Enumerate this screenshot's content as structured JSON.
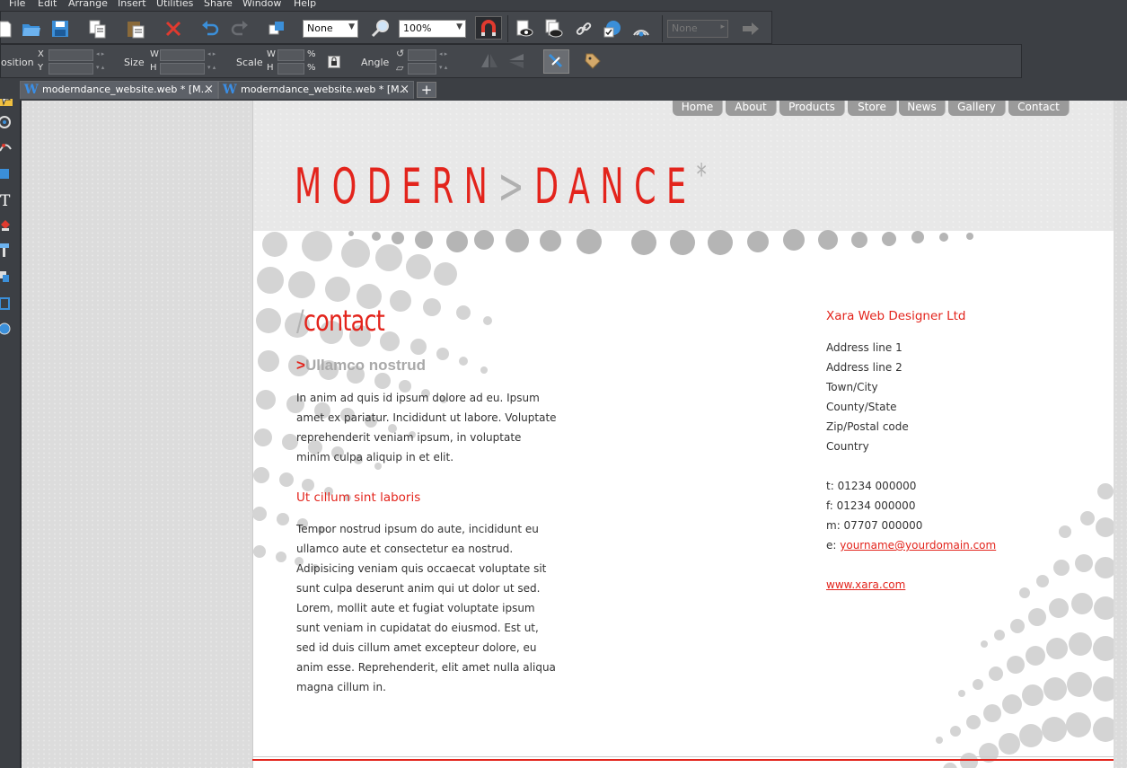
{
  "menu": [
    "File",
    "Edit",
    "Arrange",
    "Insert",
    "Utilities",
    "Share",
    "Window",
    "Help"
  ],
  "toolbar": {
    "quality_combo": "None",
    "zoom_combo": "100%",
    "right_combo": "None"
  },
  "infobar": {
    "position_label": "osition",
    "x_label": "X",
    "y_label": "Y",
    "size_label": "Size",
    "w_label": "W",
    "h_label": "H",
    "scale_label": "Scale",
    "sw_label": "W",
    "sh_label": "H",
    "pct1": "%",
    "pct2": "%",
    "angle_label": "Angle"
  },
  "tabs": [
    {
      "label": "moderndance_website.web * [M...",
      "close": "×"
    },
    {
      "label": "moderndance_website.web * [M...",
      "close": "×"
    }
  ],
  "tab_add": "+",
  "site": {
    "nav": [
      "Home",
      "About",
      "Products",
      "Store",
      "News",
      "Gallery",
      "Contact"
    ],
    "logo_left": "MODERN",
    "logo_gt": ">",
    "logo_right": "DANCE",
    "logo_star": "*",
    "heading_slash": "/",
    "heading": "contact",
    "sub1_gt": ">",
    "sub1": "Ullamco nostrud",
    "para1": [
      "In anim ad quis id ipsum dolore ad eu. Ipsum",
      "amet ex pariatur. Incididunt ut labore. Voluptate",
      "reprehenderit veniam ipsum, in voluptate",
      "minim culpa aliquip in et elit."
    ],
    "sub2": "Ut cillum sint laboris",
    "para2": [
      "Tempor nostrud ipsum do aute, incididunt eu",
      "ullamco aute et consectetur ea nostrud.",
      "Adipisicing veniam quis occaecat voluptate sit",
      "sunt culpa deserunt anim qui ut dolor ut sed.",
      "Lorem, mollit aute et fugiat voluptate ipsum",
      "sunt veniam in cupidatat do eiusmod. Est ut,",
      "sed id duis cillum amet excepteur dolore, eu",
      "anim esse. Reprehenderit, elit amet nulla aliqua",
      "magna cillum in."
    ],
    "company": "Xara Web Designer Ltd",
    "address": [
      "Address line 1",
      "Address line 2",
      "Town/City",
      "County/State",
      "Zip/Postal code",
      "Country"
    ],
    "phone_t": "t: 01234 000000",
    "phone_f": "f: 01234 000000",
    "phone_m": "m: 07707 000000",
    "email_prefix": "e: ",
    "email": "yourname@yourdomain.com",
    "website": "www.xara.com"
  },
  "colors": {
    "accent": "#e3241c",
    "grey_text": "#a9a9a9",
    "ui_bg": "#3c3f44"
  }
}
